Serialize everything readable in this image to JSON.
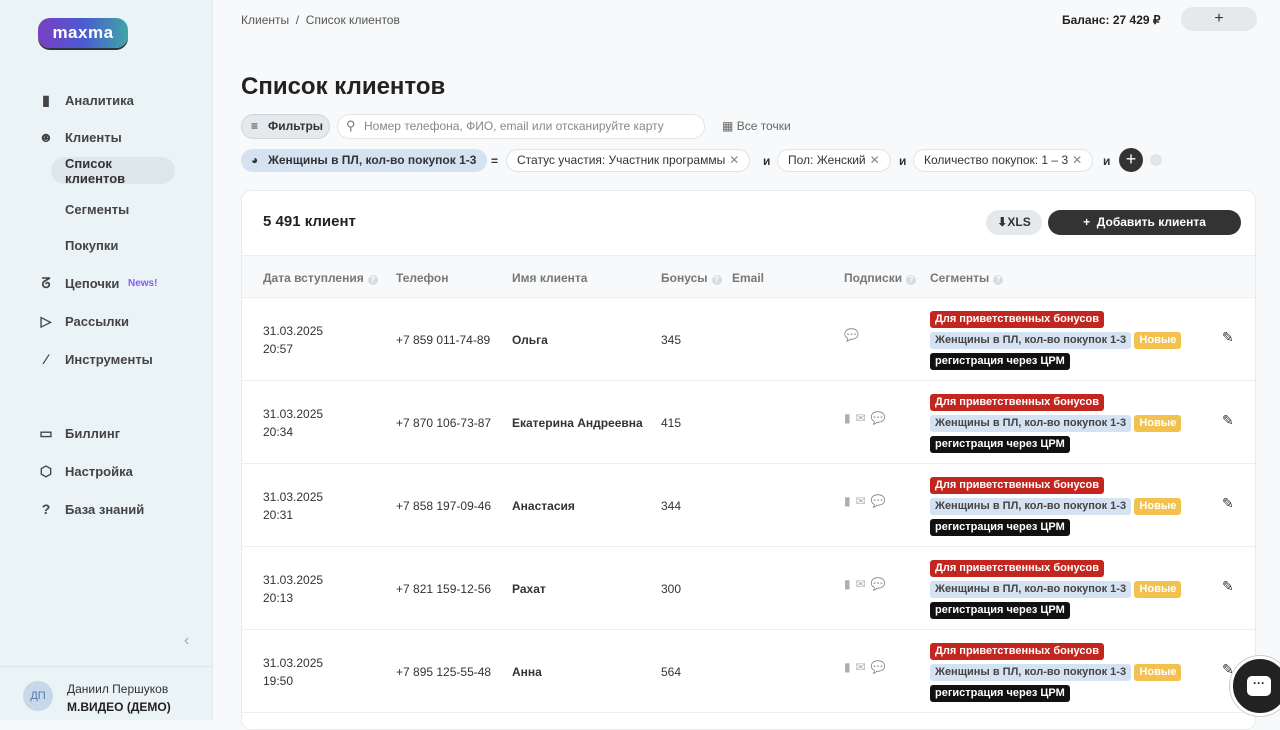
{
  "sidebar": {
    "logo": "maxma",
    "items": [
      {
        "label": "Аналитика",
        "icon": "bar-chart-icon"
      },
      {
        "label": "Клиенты",
        "icon": "smiley-icon"
      },
      {
        "label": "Список клиентов"
      },
      {
        "label": "Сегменты"
      },
      {
        "label": "Покупки"
      },
      {
        "label": "Цепочки",
        "icon": "route-icon",
        "badge": "News!"
      },
      {
        "label": "Рассылки",
        "icon": "send-icon"
      },
      {
        "label": "Инструменты",
        "icon": "magic-wand-icon"
      },
      {
        "label": "Биллинг",
        "icon": "card-icon"
      },
      {
        "label": "Настройка",
        "icon": "hexagon-icon"
      },
      {
        "label": "База знаний",
        "icon": "help-icon"
      }
    ],
    "user": {
      "initials": "ДП",
      "name": "Даниил Першуков",
      "org": "М.ВИДЕО (ДЕМО)"
    }
  },
  "header": {
    "breadcrumb": [
      "Клиенты",
      "Список клиентов"
    ],
    "balance": "Баланс: 27 429 ₽",
    "plus": "+"
  },
  "page": {
    "title": "Список клиентов"
  },
  "toolbar": {
    "filters": "Фильтры",
    "search_placeholder": "Номер телефона, ФИО, email или отсканируйте карту",
    "points": "Все точки"
  },
  "segment_filter": {
    "segment": "Женщины в ПЛ, кол-во покупок 1-3",
    "eq": "=",
    "and": "и",
    "conditions": [
      "Статус участия: Участник программы",
      "Пол: Женский",
      "Количество покупок: 1 – 3"
    ]
  },
  "table": {
    "count": "5 491 клиент",
    "xls": "XLS",
    "add": "Добавить клиента",
    "columns": [
      "Дата вступления",
      "Телефон",
      "Имя клиента",
      "Бонусы",
      "Email",
      "Подписки",
      "Сегменты"
    ],
    "segments": {
      "welcome": "Для приветственных бонусов",
      "women": "Женщины в ПЛ, кол-во покупок 1-3",
      "new": "Новые",
      "crm": "регистрация через ЦРМ"
    },
    "colors": {
      "welcome": "#c2261f",
      "women": "#d4e2f2",
      "new": "#f2c14e",
      "crm": "#111111"
    },
    "rows": [
      {
        "date": "31.03.2025",
        "time": "20:57",
        "phone": "+7 859 011-74-89",
        "name": "Ольга",
        "bonus": "345",
        "email": "",
        "subs": [
          "chat"
        ]
      },
      {
        "date": "31.03.2025",
        "time": "20:34",
        "phone": "+7 870 106-73-87",
        "name": "Екатерина Андреевна",
        "bonus": "415",
        "email": "",
        "subs": [
          "sms",
          "email",
          "chat"
        ]
      },
      {
        "date": "31.03.2025",
        "time": "20:31",
        "phone": "+7 858 197-09-46",
        "name": "Анастасия",
        "bonus": "344",
        "email": "",
        "subs": [
          "sms",
          "email",
          "chat"
        ]
      },
      {
        "date": "31.03.2025",
        "time": "20:13",
        "phone": "+7 821 159-12-56",
        "name": "Рахат",
        "bonus": "300",
        "email": "",
        "subs": [
          "sms",
          "email",
          "chat"
        ]
      },
      {
        "date": "31.03.2025",
        "time": "19:50",
        "phone": "+7 895 125-55-48",
        "name": "Анна",
        "bonus": "564",
        "email": "",
        "subs": [
          "sms",
          "email",
          "chat"
        ]
      }
    ]
  }
}
